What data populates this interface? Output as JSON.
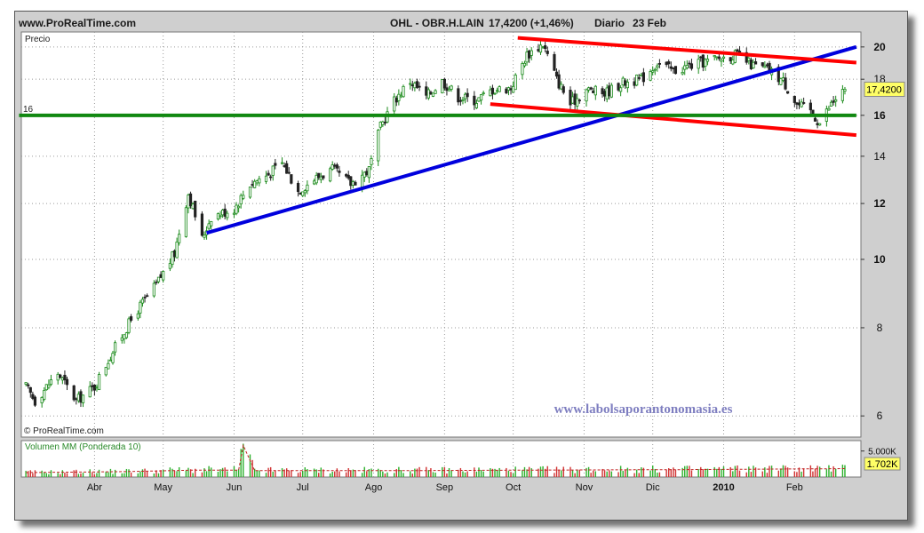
{
  "header": {
    "site": "www.ProRealTime.com",
    "instrument": "OHL - OBR.H.LAIN",
    "price_change": "17,4200 (+1,46%)",
    "period": "Diario",
    "date": "23 Feb"
  },
  "chart_data": {
    "type": "candlestick",
    "price_panel": {
      "label": "Precio",
      "scale": "log",
      "ylim": [
        5.6,
        21
      ],
      "y_ticks": [
        "20",
        "18",
        "16",
        "14",
        "12",
        "10",
        "8",
        "6"
      ],
      "last_price_label": "17,4200",
      "hline_label": "16",
      "watermark": "© ProRealTime.com",
      "annotation": "www.labolsaporantonomasia.es",
      "close_anchors": [
        [
          "2009-03-02",
          6.6
        ],
        [
          "2009-03-06",
          6.3
        ],
        [
          "2009-03-16",
          6.9
        ],
        [
          "2009-03-24",
          6.3
        ],
        [
          "2009-04-01",
          6.6
        ],
        [
          "2009-04-10",
          7.5
        ],
        [
          "2009-04-20",
          8.5
        ],
        [
          "2009-04-28",
          9.2
        ],
        [
          "2009-05-06",
          10.2
        ],
        [
          "2009-05-12",
          12.4
        ],
        [
          "2009-05-18",
          10.7
        ],
        [
          "2009-05-22",
          11.5
        ],
        [
          "2009-06-01",
          11.8
        ],
        [
          "2009-06-08",
          12.8
        ],
        [
          "2009-06-16",
          13.2
        ],
        [
          "2009-06-22",
          13.7
        ],
        [
          "2009-06-29",
          12.5
        ],
        [
          "2009-07-06",
          13.0
        ],
        [
          "2009-07-14",
          13.4
        ],
        [
          "2009-07-22",
          12.8
        ],
        [
          "2009-07-30",
          13.4
        ],
        [
          "2009-08-04",
          15.4
        ],
        [
          "2009-08-10",
          16.8
        ],
        [
          "2009-08-17",
          17.9
        ],
        [
          "2009-08-24",
          17.0
        ],
        [
          "2009-08-31",
          17.9
        ],
        [
          "2009-09-07",
          17.0
        ],
        [
          "2009-09-15",
          16.8
        ],
        [
          "2009-09-22",
          17.4
        ],
        [
          "2009-09-30",
          17.5
        ],
        [
          "2009-10-07",
          19.5
        ],
        [
          "2009-10-14",
          20.2
        ],
        [
          "2009-10-20",
          18.0
        ],
        [
          "2009-10-26",
          16.6
        ],
        [
          "2009-11-02",
          17.4
        ],
        [
          "2009-11-10",
          17.2
        ],
        [
          "2009-11-18",
          17.8
        ],
        [
          "2009-11-26",
          18.0
        ],
        [
          "2009-12-03",
          19.0
        ],
        [
          "2009-12-10",
          18.5
        ],
        [
          "2009-12-17",
          18.8
        ],
        [
          "2009-12-28",
          19.2
        ],
        [
          "2010-01-06",
          19.5
        ],
        [
          "2010-01-14",
          18.8
        ],
        [
          "2010-01-20",
          18.6
        ],
        [
          "2010-01-27",
          17.9
        ],
        [
          "2010-02-02",
          16.6
        ],
        [
          "2010-02-08",
          16.2
        ],
        [
          "2010-02-12",
          15.6
        ],
        [
          "2010-02-17",
          16.6
        ],
        [
          "2010-02-23",
          17.42
        ]
      ],
      "lines": [
        {
          "name": "",
          "color": "#0000dd",
          "from": [
            "2009-05-20",
            10.9
          ],
          "to": [
            "2010-02-28",
            20.0
          ]
        },
        {
          "name": "",
          "color": "#ff0000",
          "from": [
            "2009-10-03",
            20.6
          ],
          "to": [
            "2010-02-28",
            19.0
          ]
        },
        {
          "name": "",
          "color": "#ff0000",
          "from": [
            "2009-09-21",
            16.6
          ],
          "to": [
            "2010-02-28",
            15.0
          ]
        },
        {
          "name": "",
          "color": "#118811",
          "from": [
            "2009-02-27",
            16.0
          ],
          "to": [
            "2010-02-28",
            16.0
          ]
        }
      ]
    },
    "volume_panel": {
      "label": "Volumen MM (Ponderada 10)",
      "y_ticks": [
        "5.000K"
      ],
      "last_label": "1.702K",
      "ylim": [
        0,
        7000
      ],
      "volume_anchors": [
        [
          "2009-03-02",
          900
        ],
        [
          "2009-04-15",
          1100
        ],
        [
          "2009-05-15",
          1400
        ],
        [
          "2009-06-03",
          1400
        ],
        [
          "2009-06-05",
          6400
        ],
        [
          "2009-06-10",
          1300
        ],
        [
          "2009-08-15",
          1300
        ],
        [
          "2009-10-10",
          1400
        ],
        [
          "2009-12-14",
          1500
        ],
        [
          "2010-02-23",
          1702
        ]
      ]
    },
    "x_ticks": [
      {
        "date": "2009-04-01",
        "label": "Abr"
      },
      {
        "date": "2009-05-01",
        "label": "May"
      },
      {
        "date": "2009-06-01",
        "label": "Jun"
      },
      {
        "date": "2009-07-01",
        "label": "Jul"
      },
      {
        "date": "2009-08-01",
        "label": "Ago"
      },
      {
        "date": "2009-09-01",
        "label": "Sep"
      },
      {
        "date": "2009-10-01",
        "label": "Oct"
      },
      {
        "date": "2009-11-01",
        "label": "Nov"
      },
      {
        "date": "2009-12-01",
        "label": "Dic"
      },
      {
        "date": "2010-01-01",
        "label": "2010",
        "bold": true
      },
      {
        "date": "2010-02-01",
        "label": "Feb"
      }
    ],
    "xlim": [
      "2009-02-28",
      "2010-03-02"
    ],
    "colors": {
      "up": "#1a8a1a",
      "down": "#222222",
      "grid": "#9a9a9a",
      "panel": "#ffffff",
      "frame": "#cfcfcf"
    }
  }
}
